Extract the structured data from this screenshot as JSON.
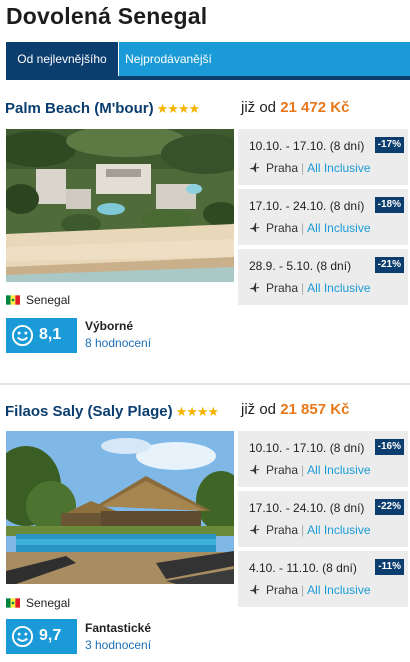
{
  "page": {
    "title": "Dovolená Senegal"
  },
  "tabs": [
    {
      "label": "Od nejlevnějšího"
    },
    {
      "label": "Nejprodávanější"
    }
  ],
  "hotels": [
    {
      "name": "Palm Beach (M'bour)",
      "stars": "★★★★",
      "price_prefix": "již od",
      "price": "21 472 Kč",
      "country": "Senegal",
      "score": "8,1",
      "rating_text": "Výborné",
      "rating_count": "8 hodnocení",
      "offers": [
        {
          "dates": "10.10. - 17.10. (8 dní)",
          "discount": "-17%",
          "departure": "Praha",
          "board": "All Inclusive"
        },
        {
          "dates": "17.10. - 24.10. (8 dní)",
          "discount": "-18%",
          "departure": "Praha",
          "board": "All Inclusive"
        },
        {
          "dates": "28.9. - 5.10. (8 dní)",
          "discount": "-21%",
          "departure": "Praha",
          "board": "All Inclusive"
        }
      ]
    },
    {
      "name": "Filaos Saly (Saly Plage)",
      "stars": "★★★★",
      "price_prefix": "již od",
      "price": "21 857 Kč",
      "country": "Senegal",
      "score": "9,7",
      "rating_text": "Fantastické",
      "rating_count": "3 hodnocení",
      "offers": [
        {
          "dates": "10.10. - 17.10. (8 dní)",
          "discount": "-16%",
          "departure": "Praha",
          "board": "All Inclusive"
        },
        {
          "dates": "17.10. - 24.10. (8 dní)",
          "discount": "-22%",
          "departure": "Praha",
          "board": "All Inclusive"
        },
        {
          "dates": "4.10. - 11.10. (8 dní)",
          "discount": "-11%",
          "departure": "Praha",
          "board": "All Inclusive"
        }
      ]
    }
  ],
  "colors": {
    "accent": "#1a9bd7",
    "navy": "#0b3e6e",
    "price": "#e8781a",
    "star": "#f5b400"
  }
}
